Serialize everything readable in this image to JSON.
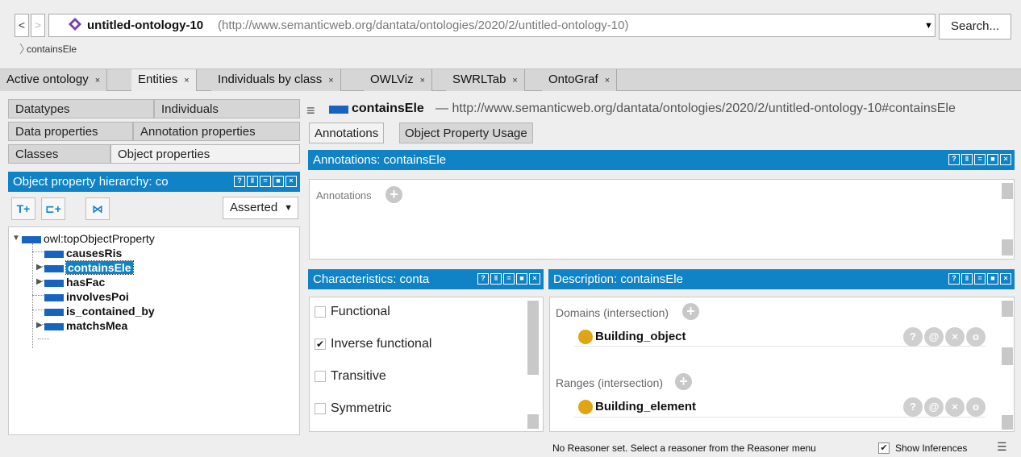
{
  "address": {
    "back": "<",
    "forward": ">",
    "ontology_name": "untitled-ontology-10",
    "ontology_iri": "(http://www.semanticweb.org/dantata/ontologies/2020/2/untitled-ontology-10)",
    "search_label": "Search...",
    "breadcrumb": "containsEle"
  },
  "tabs": [
    {
      "label": "Active ontology",
      "close": "×"
    },
    {
      "label": "Entities",
      "close": "×"
    },
    {
      "label": "Individuals by class",
      "close": "×"
    },
    {
      "label": "OWLViz",
      "close": "×"
    },
    {
      "label": "SWRLTab",
      "close": "×"
    },
    {
      "label": "OntoGraf",
      "close": "×"
    }
  ],
  "left_tabs": {
    "datatypes": "Datatypes",
    "individuals": "Individuals",
    "data_properties": "Data properties",
    "annotation_properties": "Annotation properties",
    "classes": "Classes",
    "object_properties": "Object properties"
  },
  "hierarchy": {
    "title": "Object property hierarchy: co",
    "mode": "Asserted",
    "items": [
      {
        "name": "owl:topObjectProperty"
      },
      {
        "name": "causesRis"
      },
      {
        "name": "containsEle"
      },
      {
        "name": "hasFac"
      },
      {
        "name": "involvesPoi"
      },
      {
        "name": "is_contained_by"
      },
      {
        "name": "matchsMea"
      }
    ]
  },
  "entity": {
    "name": "containsEle",
    "dash": "—",
    "iri": "http://www.semanticweb.org/dantata/ontologies/2020/2/untitled-ontology-10#containsEle"
  },
  "right_tabs": {
    "annotations": "Annotations",
    "usage": "Object Property Usage"
  },
  "annotations": {
    "title": "Annotations: containsEle",
    "label": "Annotations"
  },
  "characteristics": {
    "title": "Characteristics: conta",
    "items": [
      {
        "label": "Functional",
        "checked": false
      },
      {
        "label": "Inverse functional",
        "checked": true
      },
      {
        "label": "Transitive",
        "checked": false
      },
      {
        "label": "Symmetric",
        "checked": false
      }
    ]
  },
  "description": {
    "title": "Description: containsEle",
    "domains_label": "Domains (intersection)",
    "domain_item": "Building_object",
    "ranges_label": "Ranges (intersection)",
    "range_item": "Building_element",
    "actions": [
      "?",
      "@",
      "×",
      "o"
    ]
  },
  "status": {
    "message": "No Reasoner set. Select a reasoner from the Reasoner menu",
    "show_inferences": "Show Inferences",
    "checkmark": "✔"
  },
  "colors": {
    "accent": "#0f83c5",
    "property_icon": "#1664c0",
    "class_dot": "#e0a514"
  }
}
